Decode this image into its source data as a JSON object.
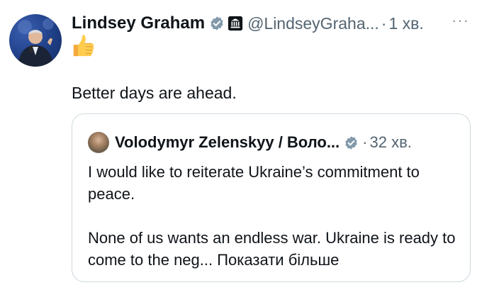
{
  "author": {
    "display_name": "Lindsey Graham",
    "handle": "@LindseyGraha...",
    "separator": "·",
    "time": "1 хв.",
    "verified_color": "#829aab",
    "more_icon": "more-horizontal-icon"
  },
  "tweet": {
    "emoji": "thumbs-up-icon",
    "text": "Better days are ahead."
  },
  "quote": {
    "display_name": "Volodymyr Zelenskyy / Воло...",
    "separator": "·",
    "time": "32 хв.",
    "paragraph_1": "I would like to reiterate Ukraine’s commitment to peace.",
    "paragraph_2": "None of us wants an endless war. Ukraine is ready to come to the neg...",
    "show_more": "Показати більше"
  }
}
